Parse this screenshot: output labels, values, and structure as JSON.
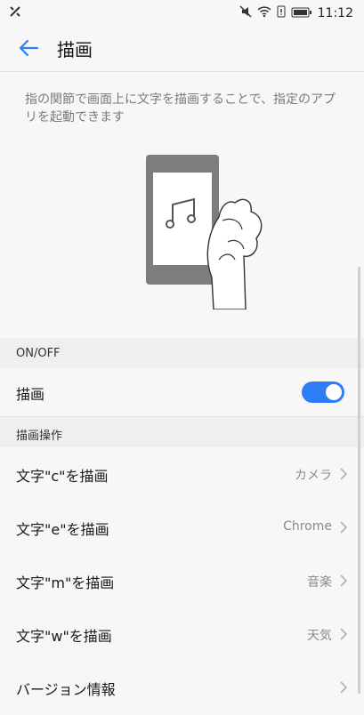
{
  "status_bar": {
    "time": "11:12"
  },
  "header": {
    "title": "描画"
  },
  "description": "指の関節で画面上に文字を描画することで、指定のアプリを起動できます",
  "sections": {
    "onoff_header": "ON/OFF",
    "draw_toggle_label": "描画",
    "operations_header": "描画操作"
  },
  "toggle": {
    "on": true,
    "color": "#2f7df6"
  },
  "items": [
    {
      "label": "文字\"c\"を描画",
      "value": "カメラ"
    },
    {
      "label": "文字\"e\"を描画",
      "value": "Chrome"
    },
    {
      "label": "文字\"m\"を描画",
      "value": "音楽"
    },
    {
      "label": "文字\"w\"を描画",
      "value": "天気"
    },
    {
      "label": "バージョン情報",
      "value": ""
    }
  ]
}
